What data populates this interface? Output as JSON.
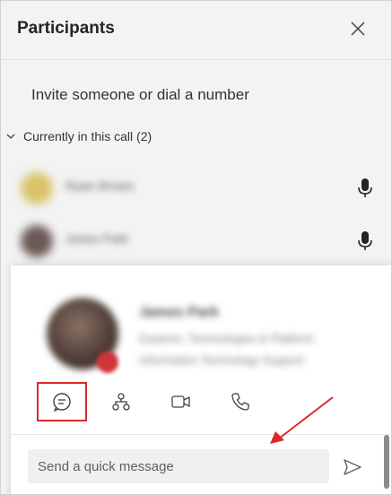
{
  "header": {
    "title": "Participants",
    "close_icon": "close-icon"
  },
  "invite": {
    "label": "Invite someone or dial a number"
  },
  "section": {
    "label": "Currently in this call (2)",
    "chevron_icon": "chevron-down-icon"
  },
  "participants": [
    {
      "name": "Ryan Brown",
      "avatar_color": "#d9c46a",
      "mic_icon": "microphone-icon"
    },
    {
      "name": "Jones Park",
      "avatar_color": "#6b5a56",
      "mic_icon": "microphone-icon"
    }
  ],
  "card": {
    "name": "James Park",
    "line1": "Explorer, Technologies & Platform",
    "line2": "Information Technology Support",
    "actions": [
      {
        "name": "chat",
        "icon": "chat-icon",
        "highlighted": true
      },
      {
        "name": "org-chart",
        "icon": "org-chart-icon",
        "highlighted": false
      },
      {
        "name": "video-call",
        "icon": "video-camera-icon",
        "highlighted": false
      },
      {
        "name": "audio-call",
        "icon": "phone-icon",
        "highlighted": false
      }
    ],
    "message_placeholder": "Send a quick message",
    "send_icon": "send-icon"
  },
  "colors": {
    "panel_bg": "#f3f3f3",
    "card_bg": "#ffffff",
    "annotation_red": "#d92a2a"
  }
}
